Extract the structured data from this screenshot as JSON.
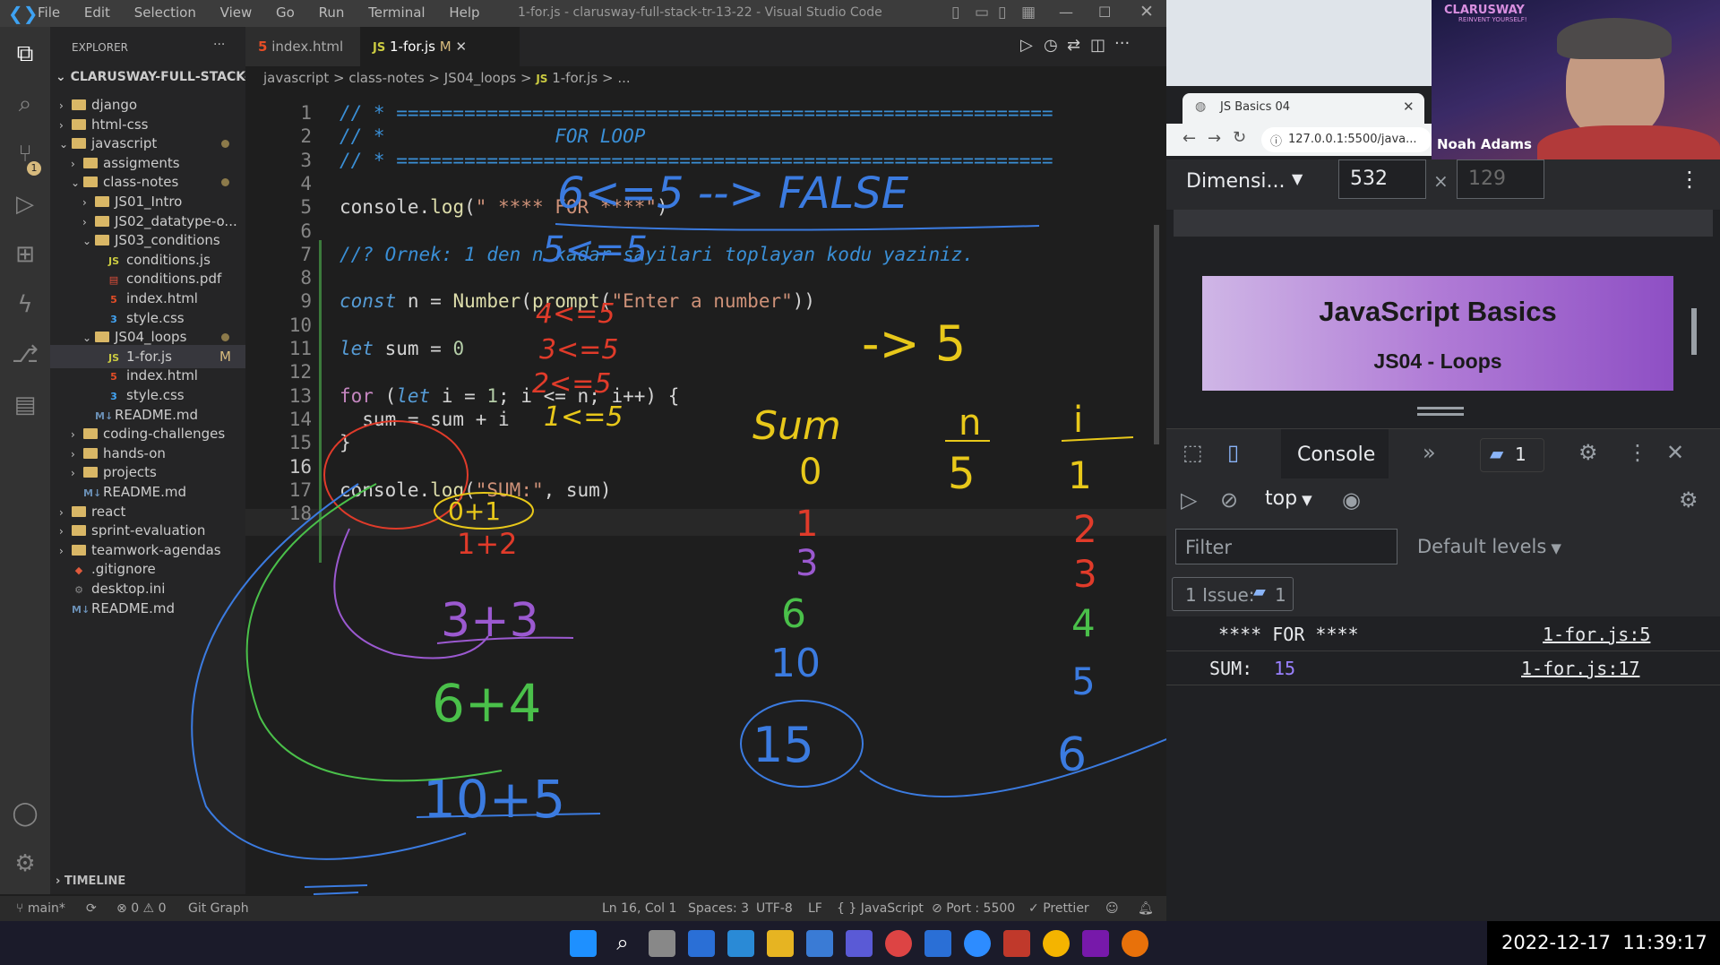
{
  "vscode": {
    "window_title": "1-for.js - clarusway-full-stack-tr-13-22 - Visual Studio Code",
    "menu": [
      "File",
      "Edit",
      "Selection",
      "View",
      "Go",
      "Run",
      "Terminal",
      "Help"
    ],
    "explorer_label": "EXPLORER",
    "workspace": "CLARUSWAY-FULL-STACK-T...",
    "tree": [
      {
        "label": "django",
        "type": "folder",
        "level": 1,
        "open": false
      },
      {
        "label": "html-css",
        "type": "folder",
        "level": 1,
        "open": false
      },
      {
        "label": "javascript",
        "type": "folder",
        "level": 1,
        "open": true,
        "dot": true
      },
      {
        "label": "assigments",
        "type": "folder",
        "level": 2,
        "open": false
      },
      {
        "label": "class-notes",
        "type": "folder",
        "level": 2,
        "open": true,
        "dot": true
      },
      {
        "label": "JS01_Intro",
        "type": "folder",
        "level": 3,
        "open": false
      },
      {
        "label": "JS02_datatype-o...",
        "type": "folder",
        "level": 3,
        "open": false
      },
      {
        "label": "JS03_conditions",
        "type": "folder",
        "level": 3,
        "open": true
      },
      {
        "label": "conditions.js",
        "type": "js",
        "level": 4
      },
      {
        "label": "conditions.pdf",
        "type": "pdf",
        "level": 4
      },
      {
        "label": "index.html",
        "type": "html",
        "level": 4
      },
      {
        "label": "style.css",
        "type": "css",
        "level": 4
      },
      {
        "label": "JS04_loops",
        "type": "folder",
        "level": 3,
        "open": true,
        "dot": true
      },
      {
        "label": "1-for.js",
        "type": "js",
        "level": 4,
        "badge": "M",
        "active": true
      },
      {
        "label": "index.html",
        "type": "html",
        "level": 4
      },
      {
        "label": "style.css",
        "type": "css",
        "level": 4
      },
      {
        "label": "README.md",
        "type": "md",
        "level": 3
      },
      {
        "label": "coding-challenges",
        "type": "folder",
        "level": 2,
        "open": false
      },
      {
        "label": "hands-on",
        "type": "folder",
        "level": 2,
        "open": false
      },
      {
        "label": "projects",
        "type": "folder",
        "level": 2,
        "open": false
      },
      {
        "label": "README.md",
        "type": "md",
        "level": 2
      },
      {
        "label": "react",
        "type": "folder",
        "level": 1,
        "open": false
      },
      {
        "label": "sprint-evaluation",
        "type": "folder",
        "level": 1,
        "open": false
      },
      {
        "label": "teamwork-agendas",
        "type": "folder",
        "level": 1,
        "open": false
      },
      {
        "label": ".gitignore",
        "type": "git",
        "level": 1
      },
      {
        "label": "desktop.ini",
        "type": "ini",
        "level": 1
      },
      {
        "label": "README.md",
        "type": "md",
        "level": 1
      }
    ],
    "timeline_label": "TIMELINE",
    "tabs": [
      {
        "label": "index.html",
        "icon": "html"
      },
      {
        "label": "1-for.js",
        "icon": "js",
        "badge": "M",
        "active": true
      }
    ],
    "breadcrumb": [
      "javascript",
      ">",
      "class-notes",
      ">",
      "JS04_loops",
      ">",
      "JS",
      "1-for.js",
      ">",
      "..."
    ],
    "code_lines": [
      "// * ==========================================================",
      "// *               FOR LOOP",
      "// * ==========================================================",
      "",
      "console.log(\" **** FOR ****\")",
      "",
      "//? Ornek: 1 den n kadar sayilari toplayan kodu yaziniz.",
      "",
      "const n = Number(prompt(\"Enter a number\"))",
      "",
      "let sum = 0",
      "",
      "for (let i = 1; i <= n; i++) {",
      "  sum = sum + i",
      "}",
      "",
      "console.log(\"SUM:\", sum)",
      ""
    ],
    "annotations": [
      "6<=5 --> FALSE",
      "5<=5",
      "4<=5",
      "3<=5",
      "2<=5",
      "1<=5",
      "-> 5",
      "0+1",
      "1+2",
      "3+3",
      "6+4",
      "10+5",
      "Sum",
      "0",
      "1",
      "3",
      "6",
      "10",
      "15",
      "n",
      "5",
      "i",
      "1",
      "2",
      "3",
      "4",
      "5",
      "6"
    ],
    "status": {
      "branch": "main*",
      "problems": "0",
      "warnings": "0",
      "git_graph": "Git Graph",
      "position": "Ln 16, Col 1",
      "spaces": "Spaces: 3",
      "encoding": "UTF-8",
      "eol": "LF",
      "language": "JavaScript",
      "port": "Port : 5500",
      "prettier": "Prettier"
    }
  },
  "browser": {
    "tab_title": "JS Basics 04",
    "url": "127.0.0.1:5500/java...",
    "webcam_name": "Noah Adams",
    "webcam_logo": "CLARUSWAY",
    "webcam_slogan": "REINVENT YOURSELF!",
    "device_mode": "Dimensi...",
    "width": "532",
    "height_placeholder": "129",
    "page_title": "JavaScript Basics",
    "page_subtitle": "JS04 - Loops",
    "devtools": {
      "active_tab": "Console",
      "issues_badge": "1",
      "context": "top",
      "filter_placeholder": "Filter",
      "levels": "Default levels",
      "issues_label": "1 Issue:",
      "issues_count": "1",
      "logs": [
        {
          "text": " **** FOR ****",
          "source": "1-for.js:5"
        },
        {
          "label": "SUM:",
          "value": "15",
          "source": "1-for.js:17"
        }
      ]
    }
  },
  "taskbar": {
    "datetime": "2022-12-17  11:39:17"
  }
}
